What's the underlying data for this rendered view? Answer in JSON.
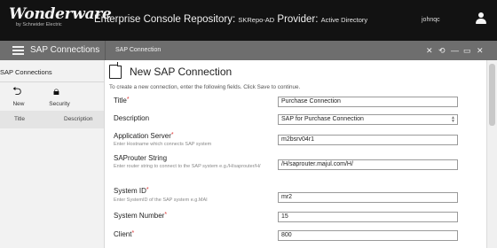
{
  "banner": {
    "logo_text": "Wonderware",
    "logo_sub": "by Schneider Electric",
    "title_main": "Enterprise Console Repository: ",
    "title_repo": "SKRepo-AD",
    "title_provider_label": " Provider: ",
    "title_provider": "Active Directory",
    "user": "johnqc",
    "user_icon": "user-icon"
  },
  "navbar": {
    "menu_icon": "hamburger-icon",
    "label": "SAP Connections",
    "panel_title": "SAP Connection",
    "controls": {
      "pin": "✕",
      "refresh": "⟲",
      "minimize": "—",
      "maximize": "▭",
      "close": "✕"
    }
  },
  "left_panel": {
    "title": "SAP Connections",
    "buttons": [
      {
        "label": "New",
        "icon": "new-icon"
      },
      {
        "label": "Security",
        "icon": "lock-icon"
      }
    ],
    "columns": [
      "Title",
      "Description"
    ]
  },
  "dialog": {
    "title": "New SAP Connection",
    "icon": "new-document-icon",
    "instructions": "To create a new connection, enter the following fields. Click Save to continue.",
    "fields": [
      {
        "label": "Title",
        "required": true,
        "hint": "",
        "value": "Purchase Connection",
        "type": "text"
      },
      {
        "label": "Description",
        "required": false,
        "hint": "",
        "value": "SAP for Purchase Connection",
        "type": "select"
      },
      {
        "label": "Application Server",
        "required": true,
        "hint": "Enter Hostname which connects SAP system",
        "value": "m2bsrv04r1",
        "type": "text"
      },
      {
        "label": "SAProuter String",
        "required": false,
        "hint": "Enter router string to connect to the SAP system e.g./H/saprouter/H/",
        "value": "/H/saprouter.majul.com/H/",
        "type": "text"
      },
      {
        "label": "System ID",
        "required": true,
        "hint": "Enter SystemID of the SAP system e.g.MAI",
        "value": "mr2",
        "type": "text"
      },
      {
        "label": "System Number",
        "required": true,
        "hint": "",
        "value": "15",
        "type": "text"
      },
      {
        "label": "Client",
        "required": true,
        "hint": "",
        "value": "800",
        "type": "text"
      }
    ]
  }
}
